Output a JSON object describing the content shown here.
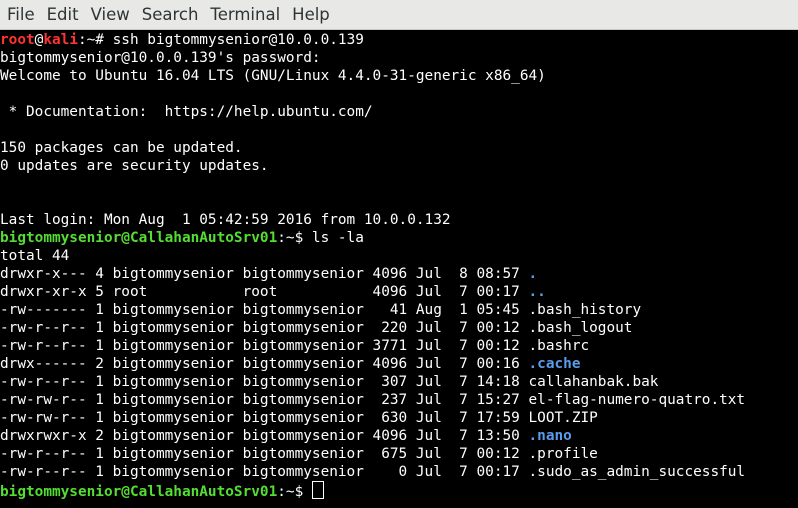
{
  "menu": [
    "File",
    "Edit",
    "View",
    "Search",
    "Terminal",
    "Help"
  ],
  "local_prompt": {
    "user": "root",
    "at": "@",
    "host": "kali",
    "rest": ":~# ",
    "command": "ssh bigtommysenior@10.0.0.139"
  },
  "ssh_lines": [
    "bigtommysenior@10.0.0.139's password:",
    "Welcome to Ubuntu 16.04 LTS (GNU/Linux 4.4.0-31-generic x86_64)",
    "",
    " * Documentation:  https://help.ubuntu.com/",
    "",
    "150 packages can be updated.",
    "0 updates are security updates.",
    "",
    "",
    "Last login: Mon Aug  1 05:42:59 2016 from 10.0.0.132"
  ],
  "remote_prompt": {
    "userhost": "bigtommysenior@CallahanAutoSrv01",
    "sep": ":~$ ",
    "command": "ls -la"
  },
  "total_line": "total 44",
  "listing": [
    {
      "meta": "drwxr-x--- 4 bigtommysenior bigtommysenior 4096 Jul  8 08:57 ",
      "name": ".",
      "dir": true
    },
    {
      "meta": "drwxr-xr-x 5 root           root           4096 Jul  7 00:17 ",
      "name": "..",
      "dir": true
    },
    {
      "meta": "-rw------- 1 bigtommysenior bigtommysenior   41 Aug  1 05:45 ",
      "name": ".bash_history",
      "dir": false
    },
    {
      "meta": "-rw-r--r-- 1 bigtommysenior bigtommysenior  220 Jul  7 00:12 ",
      "name": ".bash_logout",
      "dir": false
    },
    {
      "meta": "-rw-r--r-- 1 bigtommysenior bigtommysenior 3771 Jul  7 00:12 ",
      "name": ".bashrc",
      "dir": false
    },
    {
      "meta": "drwx------ 2 bigtommysenior bigtommysenior 4096 Jul  7 00:16 ",
      "name": ".cache",
      "dir": true
    },
    {
      "meta": "-rw-r--r-- 1 bigtommysenior bigtommysenior  307 Jul  7 14:18 ",
      "name": "callahanbak.bak",
      "dir": false
    },
    {
      "meta": "-rw-rw-r-- 1 bigtommysenior bigtommysenior  237 Jul  7 15:27 ",
      "name": "el-flag-numero-quatro.txt",
      "dir": false
    },
    {
      "meta": "-rw-rw-r-- 1 bigtommysenior bigtommysenior  630 Jul  7 17:59 ",
      "name": "LOOT.ZIP",
      "dir": false
    },
    {
      "meta": "drwxrwxr-x 2 bigtommysenior bigtommysenior 4096 Jul  7 13:50 ",
      "name": ".nano",
      "dir": true
    },
    {
      "meta": "-rw-r--r-- 1 bigtommysenior bigtommysenior  675 Jul  7 00:12 ",
      "name": ".profile",
      "dir": false
    },
    {
      "meta": "-rw-r--r-- 1 bigtommysenior bigtommysenior    0 Jul  7 00:17 ",
      "name": ".sudo_as_admin_successful",
      "dir": false
    }
  ],
  "final_prompt": {
    "userhost": "bigtommysenior@CallahanAutoSrv01",
    "sep": ":~$ "
  },
  "colors": {
    "prompt_root": "#ff3333",
    "prompt_user": "#55dd33",
    "directory": "#5a9dea",
    "text": "#ffffff",
    "background": "#000000",
    "menubar": "#e8e8e7"
  }
}
